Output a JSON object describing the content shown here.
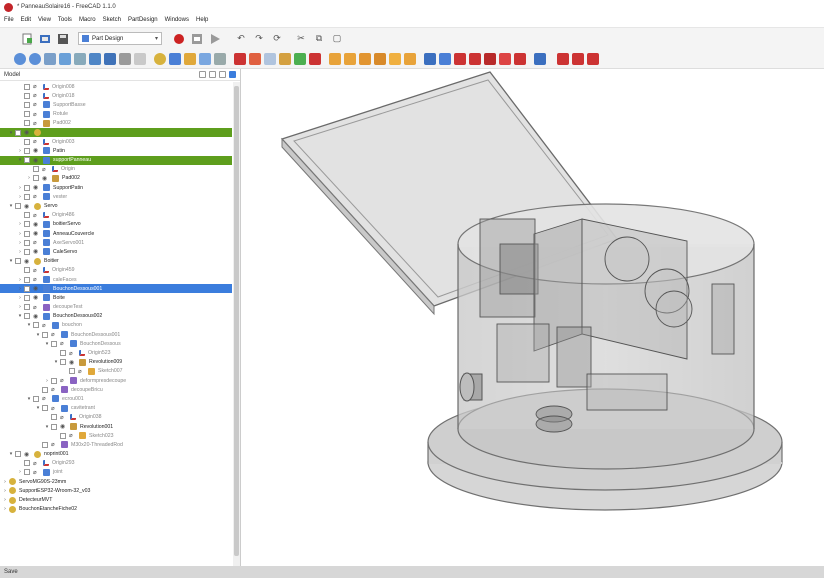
{
  "window": {
    "title": "* PanneauSolaire16 - FreeCAD 1.1.0"
  },
  "menu": {
    "items": [
      "File",
      "Edit",
      "View",
      "Tools",
      "Macro",
      "Sketch",
      "PartDesign",
      "Windows",
      "Help"
    ]
  },
  "toolbar": {
    "workbench": "Part Design",
    "colors": {
      "record": "#cc2222",
      "accent": "#4a7fd6"
    }
  },
  "panel": {
    "title": "Model"
  },
  "tree": [
    {
      "label": "Origin008",
      "depth": 1,
      "toggle": "",
      "icon": "origin",
      "hidden": true
    },
    {
      "label": "Origin018",
      "depth": 1,
      "toggle": "",
      "icon": "origin",
      "hidden": true
    },
    {
      "label": "SupportBasse",
      "depth": 1,
      "toggle": "",
      "icon": "body",
      "hidden": true
    },
    {
      "label": "Rotule",
      "depth": 1,
      "toggle": "",
      "icon": "body",
      "hidden": true
    },
    {
      "label": "Pad002",
      "depth": 1,
      "toggle": "",
      "icon": "feature",
      "hidden": true
    },
    {
      "label": "",
      "depth": 0,
      "toggle": "▾",
      "icon": "part",
      "hl": "green"
    },
    {
      "label": "Origin003",
      "depth": 1,
      "toggle": "",
      "icon": "origin",
      "hidden": true
    },
    {
      "label": "Patin",
      "depth": 1,
      "toggle": "›",
      "icon": "body"
    },
    {
      "label": "supportPanneau",
      "depth": 1,
      "toggle": "▾",
      "icon": "body",
      "hl": "green"
    },
    {
      "label": "Origin",
      "depth": 2,
      "toggle": "",
      "icon": "origin",
      "hidden": true
    },
    {
      "label": "Pad002",
      "depth": 2,
      "toggle": "›",
      "icon": "feature"
    },
    {
      "label": "SupportPatin",
      "depth": 1,
      "toggle": "›",
      "icon": "body"
    },
    {
      "label": "vester",
      "depth": 1,
      "toggle": "›",
      "icon": "body",
      "hidden": true
    },
    {
      "label": "Servo",
      "depth": 0,
      "toggle": "▾",
      "icon": "part"
    },
    {
      "label": "Origin486",
      "depth": 1,
      "toggle": "",
      "icon": "origin",
      "hidden": true
    },
    {
      "label": "boitierServo",
      "depth": 1,
      "toggle": "›",
      "icon": "body"
    },
    {
      "label": "AnneauCouvercle",
      "depth": 1,
      "toggle": "›",
      "icon": "body"
    },
    {
      "label": "AxeServo001",
      "depth": 1,
      "toggle": "›",
      "icon": "body",
      "hidden": true
    },
    {
      "label": "CaleServo",
      "depth": 1,
      "toggle": "›",
      "icon": "body"
    },
    {
      "label": "Boitier",
      "depth": 0,
      "toggle": "▾",
      "icon": "part"
    },
    {
      "label": "Origin459",
      "depth": 1,
      "toggle": "",
      "icon": "origin",
      "hidden": true
    },
    {
      "label": "caleFaces",
      "depth": 1,
      "toggle": "›",
      "icon": "body",
      "hidden": true
    },
    {
      "label": "BouchonDessous001",
      "depth": 1,
      "toggle": "›",
      "icon": "body",
      "hl": "blue"
    },
    {
      "label": "Boite",
      "depth": 1,
      "toggle": "›",
      "icon": "body"
    },
    {
      "label": "decoupeTest",
      "depth": 1,
      "toggle": "›",
      "icon": "boolean",
      "hidden": true
    },
    {
      "label": "BouchonDessous002",
      "depth": 1,
      "toggle": "▾",
      "icon": "body"
    },
    {
      "label": "bouchon",
      "depth": 2,
      "toggle": "▾",
      "icon": "body",
      "hidden": true
    },
    {
      "label": "BouchonDessous001",
      "depth": 3,
      "toggle": "▾",
      "icon": "body",
      "hidden": true
    },
    {
      "label": "BouchonDessous",
      "depth": 4,
      "toggle": "▾",
      "icon": "body",
      "hidden": true
    },
    {
      "label": "Origin523",
      "depth": 5,
      "toggle": "",
      "icon": "origin",
      "hidden": true
    },
    {
      "label": "Revolution009",
      "depth": 5,
      "toggle": "▾",
      "icon": "feature"
    },
    {
      "label": "Sketch007",
      "depth": 6,
      "toggle": "",
      "icon": "sketch",
      "hidden": true
    },
    {
      "label": "deformpresdecoupe",
      "depth": 4,
      "toggle": "›",
      "icon": "boolean",
      "hidden": true
    },
    {
      "label": "decoupeBricu",
      "depth": 3,
      "toggle": "",
      "icon": "boolean",
      "hidden": true
    },
    {
      "label": "ecrou001",
      "depth": 2,
      "toggle": "▾",
      "icon": "body",
      "hidden": true
    },
    {
      "label": "cavitetrant",
      "depth": 3,
      "toggle": "▾",
      "icon": "body",
      "hidden": true
    },
    {
      "label": "Origin038",
      "depth": 4,
      "toggle": "",
      "icon": "origin",
      "hidden": true
    },
    {
      "label": "Revolution001",
      "depth": 4,
      "toggle": "▾",
      "icon": "feature"
    },
    {
      "label": "Sketch023",
      "depth": 5,
      "toggle": "",
      "icon": "sketch",
      "hidden": true
    },
    {
      "label": "M30x20-ThreadedRod",
      "depth": 3,
      "toggle": "",
      "icon": "boolean",
      "hidden": true
    },
    {
      "label": "noprint001",
      "depth": 0,
      "toggle": "▾",
      "icon": "part"
    },
    {
      "label": "Origin293",
      "depth": 1,
      "toggle": "",
      "icon": "origin",
      "hidden": true
    },
    {
      "label": "joint",
      "depth": 1,
      "toggle": "›",
      "icon": "body",
      "hidden": true
    },
    {
      "label": "ServoMG90S-23mm",
      "depth": -1,
      "toggle": "›",
      "icon": "part"
    },
    {
      "label": "SupportESP32-Wroom-32_v03",
      "depth": -1,
      "toggle": "›",
      "icon": "part"
    },
    {
      "label": "DetecteurMVT",
      "depth": -1,
      "toggle": "›",
      "icon": "part"
    },
    {
      "label": "BouchonEtancheFiche02",
      "depth": -1,
      "toggle": "›",
      "icon": "part"
    }
  ],
  "status": {
    "text": "Save"
  }
}
